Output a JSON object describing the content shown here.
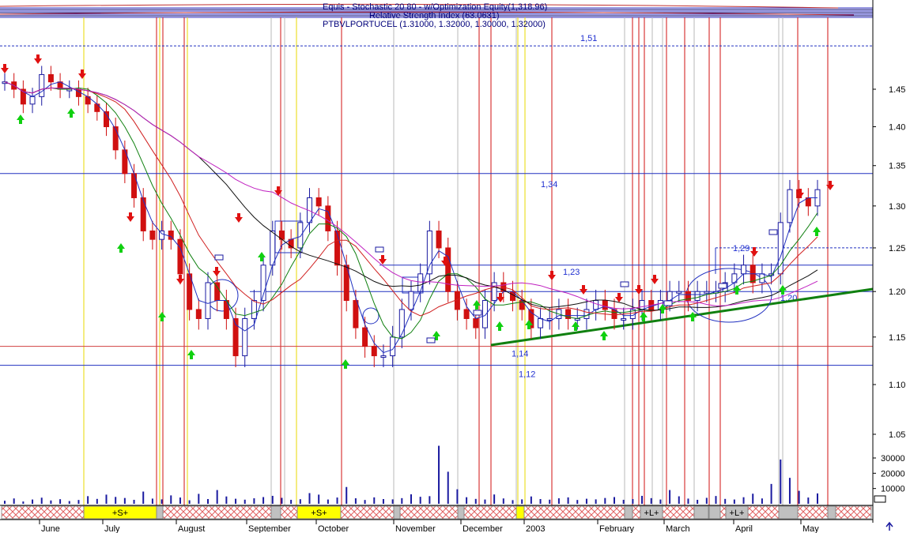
{
  "header": {
    "line1": "Equis - Stochastic 20 80 - w/Optimization Equity(1,318.96)",
    "line2": "Relative Strength Index (63.0631)",
    "line3": "PTBVLPORTUCEL (1.31000, 1.32000, 1.30000, 1.32000)"
  },
  "chart_data": {
    "type": "candlestick",
    "title": "PTBVLPORTUCEL (1.31000, 1.32000, 1.30000, 1.32000)",
    "xlabel": "",
    "ylabel": "",
    "ylim": [
      1.03,
      1.55
    ],
    "y_scale": "log",
    "price_ticks": [
      "1.45",
      "1.40",
      "1.35",
      "1.30",
      "1.25",
      "1.20",
      "1.15",
      "1.10",
      "1.05"
    ],
    "volume_ticks": [
      "30000",
      "20000",
      "10000"
    ],
    "months": [
      "June",
      "July",
      "August",
      "September",
      "October",
      "November",
      "December",
      "2003",
      "February",
      "March",
      "April",
      "May"
    ],
    "levels": [
      {
        "label": "1,51",
        "value": 1.51
      },
      {
        "label": "1,34",
        "value": 1.34
      },
      {
        "label": "1,29",
        "value": 1.25
      },
      {
        "label": "1,23",
        "value": 1.23
      },
      {
        "label": "1,20",
        "value": 1.2
      },
      {
        "label": "1,14",
        "value": 1.14
      },
      {
        "label": "1,12",
        "value": 1.12
      }
    ],
    "period_labels": [
      "+S+",
      "+S+",
      "+L+",
      "+L+"
    ],
    "price_close": [
      1.46,
      1.45,
      1.43,
      1.44,
      1.47,
      1.46,
      1.45,
      1.45,
      1.44,
      1.43,
      1.42,
      1.4,
      1.37,
      1.34,
      1.31,
      1.27,
      1.26,
      1.27,
      1.26,
      1.22,
      1.18,
      1.17,
      1.21,
      1.19,
      1.17,
      1.13,
      1.17,
      1.19,
      1.23,
      1.27,
      1.26,
      1.25,
      1.28,
      1.31,
      1.3,
      1.27,
      1.23,
      1.19,
      1.16,
      1.14,
      1.13,
      1.13,
      1.15,
      1.18,
      1.2,
      1.22,
      1.27,
      1.25,
      1.2,
      1.18,
      1.17,
      1.16,
      1.19,
      1.21,
      1.2,
      1.19,
      1.18,
      1.16,
      1.17,
      1.17,
      1.18,
      1.17,
      1.17,
      1.18,
      1.19,
      1.18,
      1.17,
      1.17,
      1.18,
      1.19,
      1.18,
      1.19,
      1.2,
      1.2,
      1.19,
      1.2,
      1.2,
      1.2,
      1.21,
      1.22,
      1.23,
      1.21,
      1.22,
      1.22,
      1.28,
      1.32,
      1.31,
      1.3,
      1.32
    ],
    "volume": [
      2000,
      3500,
      1500,
      2800,
      4000,
      2200,
      3000,
      1800,
      2500,
      5000,
      3200,
      6000,
      4500,
      3800,
      2600,
      8000,
      3400,
      2900,
      5500,
      4100,
      2300,
      6500,
      3100,
      9000,
      4800,
      3300,
      2700,
      3600,
      4400,
      5200,
      3900,
      2600,
      3000,
      7000,
      6000,
      2800,
      4100,
      11000,
      3600,
      2500,
      4200,
      3100,
      2900,
      3700,
      6200,
      4600,
      5000,
      38000,
      21000,
      9500,
      4300,
      3200,
      2800,
      6100,
      3500,
      2400,
      2900,
      4800,
      3100,
      2700,
      3600,
      4200,
      2500,
      3300,
      2900,
      3800,
      4400,
      2600,
      3100,
      5200,
      3700,
      2800,
      9000,
      4900,
      3400,
      2600,
      3900,
      5100,
      3200,
      2800,
      4300,
      6600,
      3500,
      13000,
      29000,
      17000,
      8500,
      4100,
      6800
    ]
  },
  "band": {
    "labels": [
      "+S+",
      "+S+",
      "+L+",
      "+L+"
    ]
  }
}
